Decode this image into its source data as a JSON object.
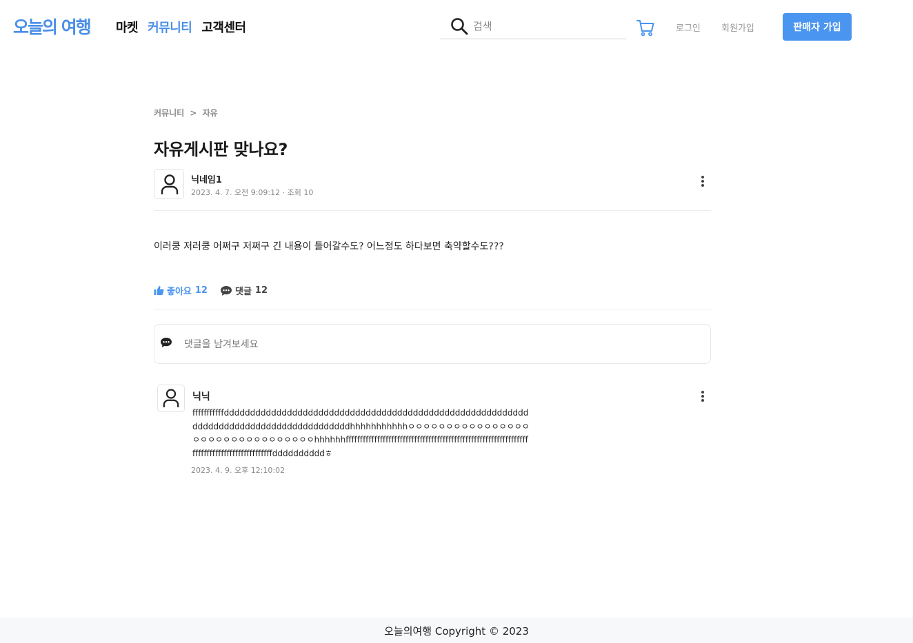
{
  "header": {
    "logo": "오늘의 여행",
    "nav": [
      {
        "label": "마켓",
        "active": false
      },
      {
        "label": "커뮤니티",
        "active": true
      },
      {
        "label": "고객센터",
        "active": false
      }
    ],
    "search_placeholder": "검색",
    "cart_icon": "cart-icon",
    "login_label": "로그인",
    "signup_label": "회원가입",
    "seller_button_label": "판매자 가입",
    "accent_color": "#4a95ef"
  },
  "breadcrumb": {
    "parent": "커뮤니티",
    "separator": ">",
    "current": "자유"
  },
  "post": {
    "title": "자유게시판 맞나요?",
    "author": "닉네임1",
    "meta": "2023. 4. 7. 오전 9:09:12 · 조회 10",
    "body": "이러쿵 저러쿵 어쩌구 저쩌구 긴 내용이 들어갈수도? 어느정도 하다보면 축약할수도???",
    "like_label": "좋아요",
    "like_count": "12",
    "comment_label": "댓글",
    "comment_count": "12"
  },
  "comment_input": {
    "placeholder": "댓글을 남겨보세요"
  },
  "comments": [
    {
      "author": "닉닉",
      "text": "fffffffffffddddddddddddddddddddddddddddddddddddddddddddddddddddddddddddddddddddddddddddddddddddddddhhhhhhhhhhhㅇㅇㅇㅇㅇㅇㅇㅇㅇㅇㅇㅇㅇㅇㅇㅇㅇㅇㅇㅇㅇㅇㅇㅇㅇㅇㅇㅇㅇㅇㅇㅇhhhhhhffffffffffffffffffffffffffffffffffffffffffffffffffffffffffffffffffffffffffffffffffffffffffffddddddddddㅎ",
      "date": "2023. 4. 9. 오후 12:10:02"
    }
  ],
  "footer": {
    "text": "오늘의여행 Copyright © 2023"
  }
}
